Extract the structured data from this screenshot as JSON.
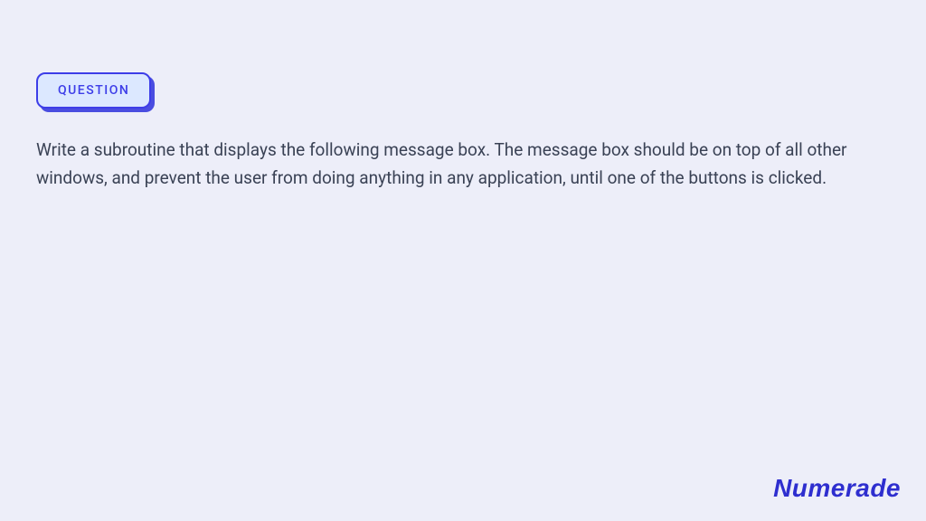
{
  "badge": {
    "label": "QUESTION"
  },
  "question": {
    "text": "Write a subroutine that displays the following message box. The message box should be on top of all other windows, and prevent the user from doing anything in any application, until one of the buttons is clicked."
  },
  "brand": {
    "name": "Numerade"
  }
}
